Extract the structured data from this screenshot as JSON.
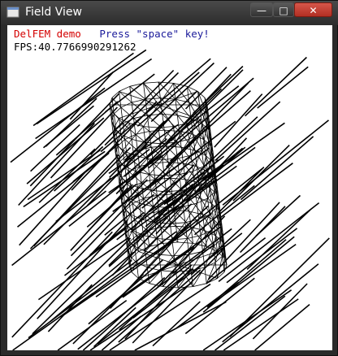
{
  "window": {
    "title": "Field View",
    "controls": {
      "minimize": "—",
      "maximize": "□",
      "close": "✕"
    }
  },
  "overlay": {
    "demo_label": "DelFEM demo",
    "prompt": "Press \"space\" key!",
    "fps": "FPS:40.7766990291262"
  },
  "colors": {
    "demo_label": "#d40000",
    "prompt": "#1a1a9a",
    "vectors": "#000000",
    "mesh": "#000000",
    "viewport_bg": "#ffffff"
  },
  "icons": {
    "app": "window-icon"
  }
}
